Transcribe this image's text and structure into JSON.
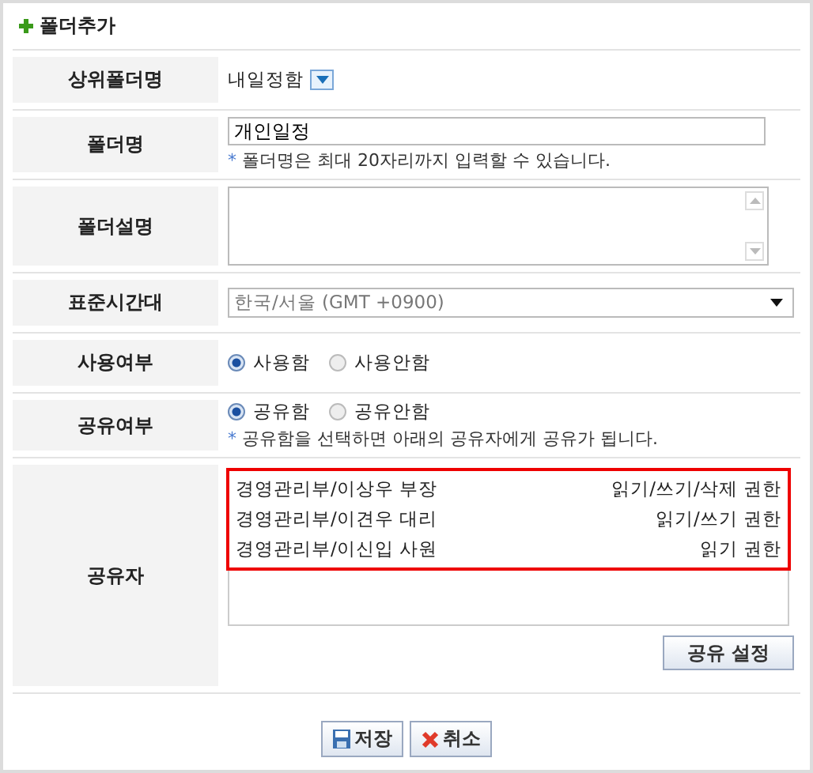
{
  "title": "폴더추가",
  "rows": [
    {
      "kind": "dropdown-text",
      "label": "상위폴더명",
      "value": "내일정함"
    },
    {
      "kind": "input",
      "label": "폴더명",
      "value": "개인일정",
      "note_mark": "*",
      "note": "폴더명은 최대 20자리까지 입력할 수 있습니다."
    },
    {
      "kind": "textarea",
      "label": "폴더설명"
    },
    {
      "kind": "select",
      "label": "표준시간대",
      "value": "한국/서울 (GMT +0900)"
    },
    {
      "kind": "radio",
      "label": "사용여부",
      "options": [
        {
          "label": "사용함",
          "selected": true
        },
        {
          "label": "사용안함",
          "selected": false
        }
      ]
    },
    {
      "kind": "radio",
      "label": "공유여부",
      "options": [
        {
          "label": "공유함",
          "selected": true
        },
        {
          "label": "공유안함",
          "selected": false
        }
      ],
      "note_mark": "*",
      "note": "공유함을 선택하면 아래의 공유자에게 공유가 됩니다."
    },
    {
      "kind": "sharers",
      "label": "공유자",
      "sharers": [
        {
          "name": "경영관리부/이상우 부장",
          "permission": "읽기/쓰기/삭제 권한"
        },
        {
          "name": "경영관리부/이견우 대리",
          "permission": "읽기/쓰기 권한"
        },
        {
          "name": "경영관리부/이신입 사원",
          "permission": "읽기 권한"
        }
      ],
      "button": "공유 설정"
    }
  ],
  "buttons": [
    {
      "kind": "save",
      "label": "저장"
    },
    {
      "kind": "cancel",
      "label": "취소"
    }
  ]
}
